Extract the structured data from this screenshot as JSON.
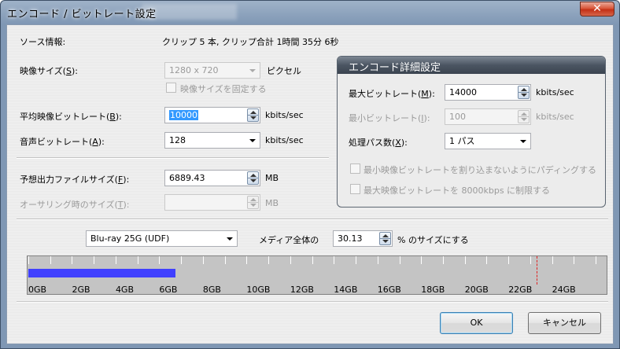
{
  "window": {
    "title": "エンコード / ビットレート設定",
    "close_glyph": "✕"
  },
  "source": {
    "label": "ソース情報:",
    "value": "クリップ 5 本, クリップ合計 1時間 35分 6秒"
  },
  "video_size": {
    "label": "映像サイズ(",
    "accel": "S",
    "label_end": "):",
    "value": "1280 x 720",
    "unit": "ピクセル",
    "fix_label": "映像サイズを固定する"
  },
  "avg_bitrate": {
    "label": "平均映像ビットレート(",
    "accel": "B",
    "label_end": "):",
    "value": "10000",
    "unit": "kbits/sec"
  },
  "audio_bitrate": {
    "label": "音声ビットレート(",
    "accel": "A",
    "label_end": "):",
    "value": "128",
    "unit": "kbits/sec"
  },
  "est_size": {
    "label": "予想出力ファイルサイズ(",
    "accel": "F",
    "label_end": "):",
    "value": "6889.43",
    "unit": "MB"
  },
  "oversize": {
    "label": "オーサリング時のサイズ(",
    "accel": "T",
    "label_end": "):",
    "value": "",
    "unit": "MB"
  },
  "advanced": {
    "title": "エンコード詳細設定",
    "max_label": "最大ビットレート(",
    "max_accel": "M",
    "max_label_end": "):",
    "max_value": "14000",
    "max_unit": "kbits/sec",
    "min_label": "最小ビットレート(",
    "min_accel": "I",
    "min_label_end": "):",
    "min_value": "100",
    "min_unit": "kbits/sec",
    "pass_label": "処理パス数(",
    "pass_accel": "X",
    "pass_label_end": "):",
    "pass_value": "1 パス",
    "padding_label": "最小映像ビットレートを割り込まないようにパディングする",
    "limit_label": "最大映像ビットレートを 8000kbps に制限する"
  },
  "media": {
    "selected": "Blu-ray 25G (UDF)",
    "ratio_label": "メディア全体の",
    "ratio_value": "30.13",
    "ratio_suffix": "% のサイズにする"
  },
  "gauge": {
    "labels": [
      "0GB",
      "2GB",
      "4GB",
      "6GB",
      "8GB",
      "10GB",
      "12GB",
      "14GB",
      "16GB",
      "18GB",
      "20GB",
      "22GB",
      "24GB"
    ],
    "fill_gb": 6.73,
    "limit_gb": 23.3,
    "max_gb": 26.5,
    "fill_color": "#4040ff",
    "limit_color": "#e02020"
  },
  "buttons": {
    "ok": "OK",
    "cancel": "キャンセル"
  }
}
